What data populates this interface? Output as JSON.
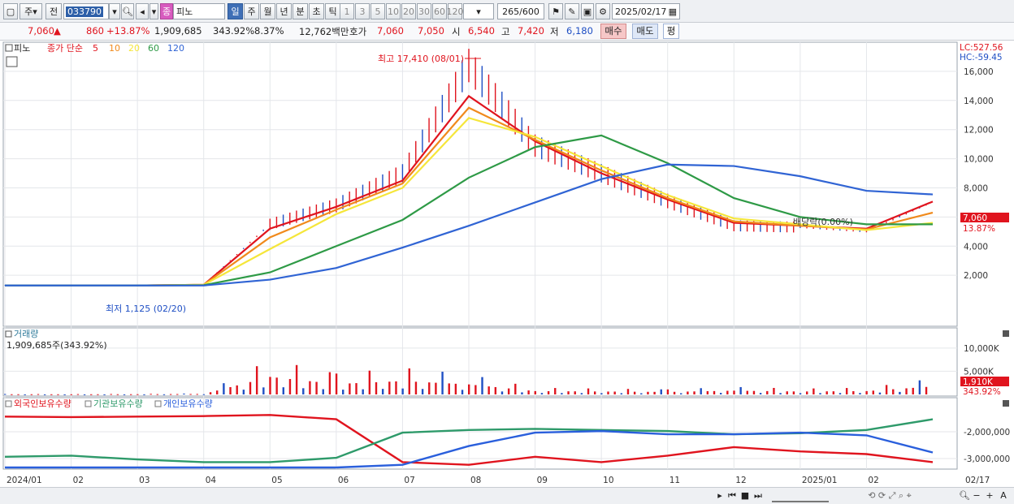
{
  "toolbar": {
    "period_label": "주",
    "prev_label": "전",
    "stock_code": "033790",
    "stock_name": "피노",
    "stock_badge": "종",
    "interval_buttons": [
      "일",
      "주",
      "월",
      "년",
      "분",
      "초",
      "틱"
    ],
    "tick_buttons": [
      "1",
      "3",
      "5",
      "10",
      "20",
      "30",
      "60",
      "120"
    ],
    "count_display": "265",
    "count_max": "/600",
    "date_value": "2025/02/17"
  },
  "quote": {
    "price": "7,060",
    "change": "860",
    "change_pct": "+13.87%",
    "volume": "1,909,685",
    "vol_ratio": "343.92%",
    "turnover": "8.37%",
    "amount": "12,762백만",
    "bid_label": "호가",
    "ask_price": "7,060",
    "bid_price": "7,050",
    "open_label": "시",
    "open_price": "6,540",
    "high_label": "고",
    "high_price": "7,420",
    "low_label": "저",
    "low_price": "6,180",
    "buy_label": "매수",
    "sell_label": "매도",
    "eval_label": "평"
  },
  "price_panel": {
    "legend_name": "피노",
    "legend_title": "종가 단순",
    "ma_labels": [
      "5",
      "10",
      "20",
      "60",
      "120"
    ],
    "ma_colors": [
      "#e0141e",
      "#f08a1c",
      "#f5e63a",
      "#2e9a46",
      "#3064d4"
    ],
    "lc_label": "LC:527.56",
    "hc_label": "HC:-59.45",
    "high_annotation": "최고 17,410 (08/01)",
    "low_annotation": "최저 1,125 (02/20)",
    "dividend_annotation": "배당락(0.00%)",
    "current_price_tag": "7,060",
    "current_pct_tag": "13.87%",
    "y_ticks": [
      "16,000",
      "14,000",
      "12,000",
      "10,000",
      "8,000",
      "6,000",
      "4,000",
      "2,000"
    ]
  },
  "volume_panel": {
    "title": "거래량",
    "value_label": "1,909,685주(343.92%)",
    "y_ticks": [
      "10,000K",
      "5,000K"
    ],
    "tag_value": "1,910K",
    "tag_pct": "343.92%"
  },
  "holding_panel": {
    "series_labels": [
      "외국인보유수량",
      "기관보유수량",
      "개인보유수량"
    ],
    "series_colors": [
      "#e0141e",
      "#2e9a6a",
      "#2a5fdc"
    ],
    "y_ticks": [
      "-2,000,000",
      "-3,000,000"
    ]
  },
  "x_axis": {
    "labels": [
      "2024/01",
      "02",
      "03",
      "04",
      "05",
      "06",
      "07",
      "08",
      "09",
      "10",
      "11",
      "12",
      "2025/01",
      "02",
      "02/17"
    ]
  },
  "chart_data": {
    "type": "line",
    "title": "",
    "x": [
      "2024/01",
      "02",
      "03",
      "04",
      "05",
      "06",
      "07",
      "08",
      "09",
      "10",
      "11",
      "12",
      "2025/01",
      "02",
      "02/17"
    ],
    "ylim": [
      0,
      17500
    ],
    "series": [
      {
        "name": "5",
        "values": [
          1300,
          1300,
          1300,
          1350,
          5200,
          6700,
          8500,
          14300,
          11200,
          9000,
          7200,
          5600,
          5400,
          5200,
          7060
        ]
      },
      {
        "name": "10",
        "values": [
          1300,
          1300,
          1300,
          1350,
          4600,
          6500,
          8300,
          13500,
          11300,
          9200,
          7300,
          5700,
          5400,
          5150,
          6300
        ]
      },
      {
        "name": "20",
        "values": [
          1300,
          1300,
          1300,
          1350,
          3800,
          6200,
          8000,
          12800,
          11500,
          9500,
          7500,
          5900,
          5500,
          5100,
          5600
        ]
      },
      {
        "name": "60",
        "values": [
          1300,
          1300,
          1300,
          1320,
          2200,
          4000,
          5800,
          8700,
          10800,
          11600,
          9700,
          7300,
          6000,
          5500,
          5500
        ]
      },
      {
        "name": "120",
        "values": [
          1300,
          1300,
          1300,
          1300,
          1700,
          2500,
          3900,
          5400,
          7000,
          8600,
          9600,
          9500,
          8800,
          7800,
          7550
        ]
      }
    ],
    "candle_close": [
      1300,
      1300,
      1300,
      1350,
      5500,
      6800,
      9000,
      16400,
      10900,
      9000,
      7100,
      5400,
      5300,
      5000,
      7060
    ],
    "volume_k": [
      50,
      40,
      60,
      120,
      4200,
      2500,
      3200,
      2400,
      800,
      700,
      600,
      900,
      700,
      800,
      1910
    ]
  }
}
